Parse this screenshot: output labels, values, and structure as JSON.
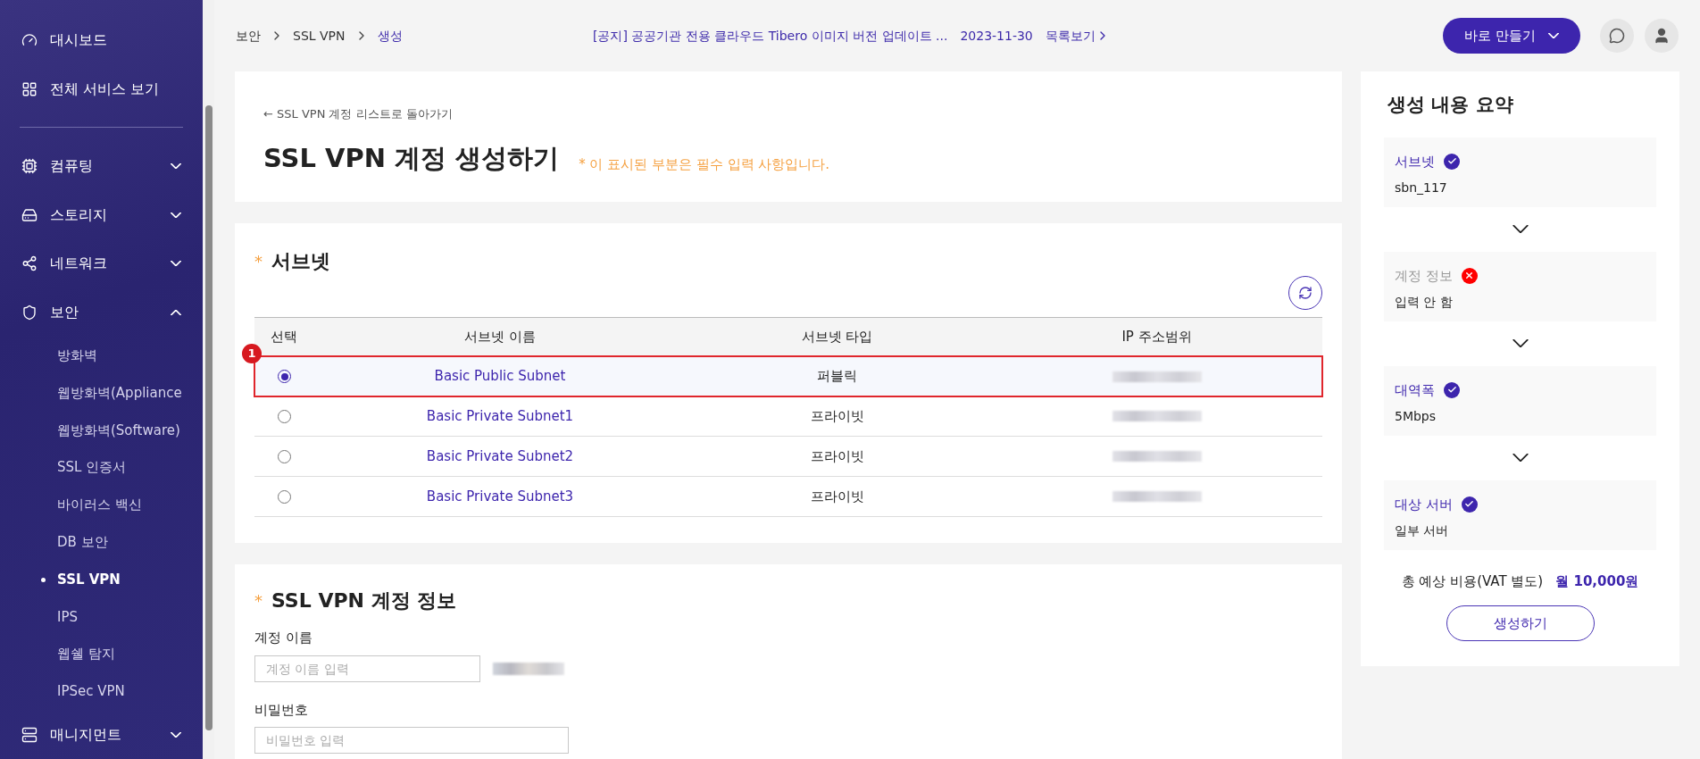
{
  "sidebar": {
    "items": [
      {
        "label": "대시보드"
      },
      {
        "label": "전체 서비스 보기"
      },
      {
        "label": "컴퓨팅",
        "expanded": false
      },
      {
        "label": "스토리지",
        "expanded": false
      },
      {
        "label": "네트워크",
        "expanded": false
      },
      {
        "label": "보안",
        "expanded": true,
        "children": [
          {
            "label": "방화벽",
            "selected": false
          },
          {
            "label": "웹방화벽(Appliance",
            "selected": false
          },
          {
            "label": "웹방화벽(Software)",
            "selected": false
          },
          {
            "label": "SSL 인증서",
            "selected": false
          },
          {
            "label": "바이러스 백신",
            "selected": false
          },
          {
            "label": "DB 보안",
            "selected": false
          },
          {
            "label": "SSL VPN",
            "selected": true
          },
          {
            "label": "IPS",
            "selected": false
          },
          {
            "label": "웹쉘 탐지",
            "selected": false
          },
          {
            "label": "IPSec VPN",
            "selected": false
          }
        ]
      },
      {
        "label": "매니지먼트",
        "expanded": false
      }
    ]
  },
  "breadcrumb": [
    "보안",
    "SSL VPN",
    "생성"
  ],
  "notice": {
    "text": "[공지] 공공기관 전용 클라우드 Tibero 이미지 버전 업데이트 ...",
    "date": "2023-11-30",
    "link": "목록보기"
  },
  "create_button": "바로 만들기",
  "header": {
    "back_link": "← SSL VPN 계정 리스트로 돌아가기",
    "title": "SSL VPN 계정 생성하기",
    "required_note": "* 이 표시된 부분은 필수 입력 사항입니다."
  },
  "subnet_section": {
    "title": "서브넷",
    "marker": "*",
    "table": {
      "columns": [
        "선택",
        "서브넷 이름",
        "서브넷 타입",
        "IP 주소범위"
      ],
      "rows": [
        {
          "name": "Basic Public Subnet",
          "type": "퍼블릭",
          "selected": true,
          "annotation": "1"
        },
        {
          "name": "Basic Private Subnet1",
          "type": "프라이빗",
          "selected": false
        },
        {
          "name": "Basic Private Subnet2",
          "type": "프라이빗",
          "selected": false
        },
        {
          "name": "Basic Private Subnet3",
          "type": "프라이빗",
          "selected": false
        }
      ]
    }
  },
  "account_section": {
    "title": "SSL VPN 계정 정보",
    "marker": "*",
    "fields": [
      {
        "label": "계정 이름",
        "placeholder": "계정 이름 입력",
        "suffix_redacted": true
      },
      {
        "label": "비밀번호",
        "placeholder": "비밀번호 입력",
        "suffix_redacted": false
      }
    ]
  },
  "summary": {
    "title": "생성 내용 요약",
    "items": [
      {
        "label": "서브넷",
        "complete": true,
        "value": "sbn_117"
      },
      {
        "label": "계정 정보",
        "complete": false,
        "value": "입력 안 함"
      },
      {
        "label": "대역폭",
        "complete": true,
        "value": "5Mbps"
      },
      {
        "label": "대상 서버",
        "complete": true,
        "value": "일부 서버"
      }
    ],
    "cost_label": "총 예상 비용(VAT 별도)",
    "cost_value": "월 10,000원",
    "submit": "생성하기"
  }
}
